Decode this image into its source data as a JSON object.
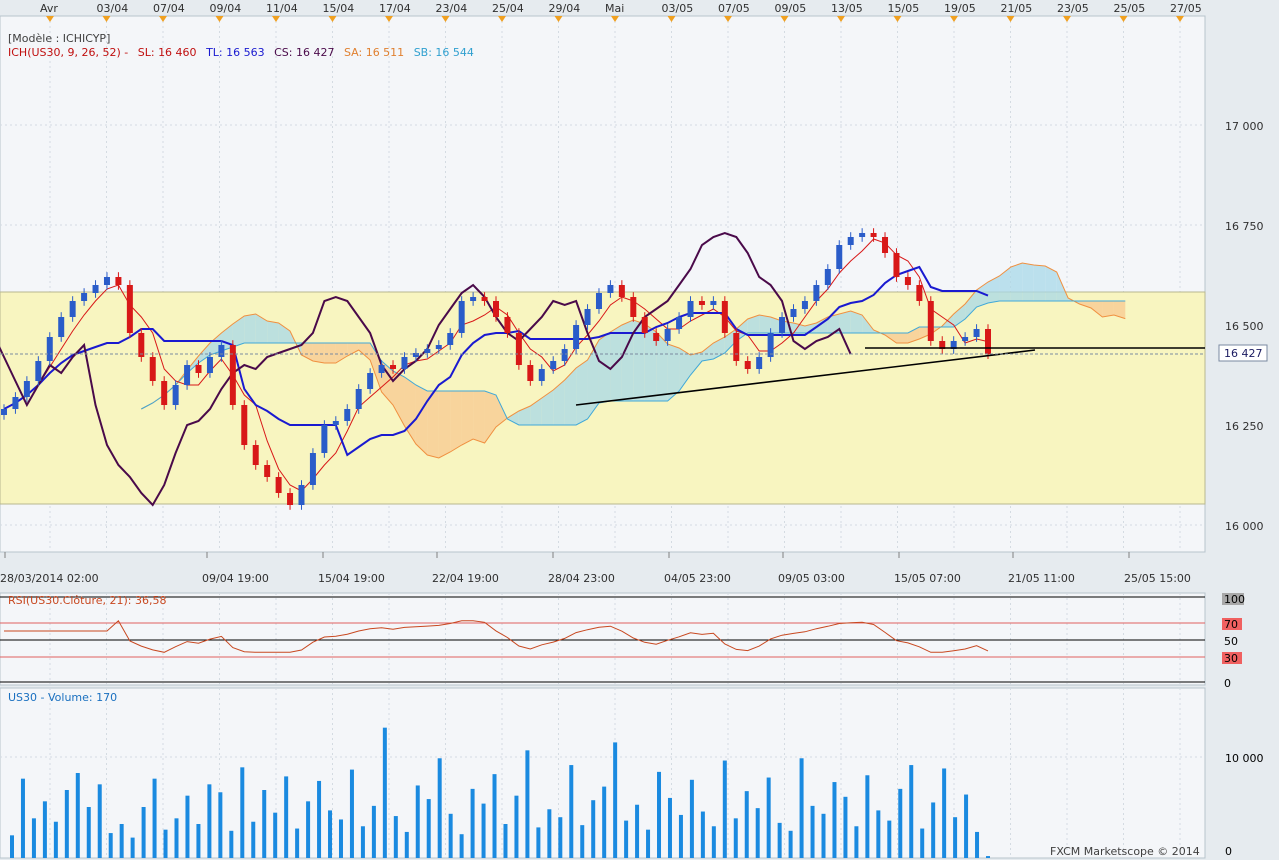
{
  "header": {
    "model_label": "[Modèle : ICHICYP]",
    "ich_prefix": "ICH(US30, 9, 26, 52) -",
    "sl": "SL: 16 460",
    "tl": "TL: 16 563",
    "cs": "CS: 16 427",
    "sa": "SA: 16 511",
    "sb": "SB: 16 544"
  },
  "top_dates": [
    "Avr",
    "03/04",
    "07/04",
    "09/04",
    "11/04",
    "15/04",
    "17/04",
    "23/04",
    "25/04",
    "29/04",
    "Mai",
    "03/05",
    "07/05",
    "09/05",
    "13/05",
    "15/05",
    "19/05",
    "21/05",
    "23/05",
    "25/05",
    "27/05"
  ],
  "time_axis": [
    "28/03/2014 02:00",
    "09/04 19:00",
    "15/04 19:00",
    "22/04 19:00",
    "28/04 23:00",
    "04/05 23:00",
    "09/05 03:00",
    "15/05 07:00",
    "21/05 11:00",
    "25/05 15:00"
  ],
  "price_axis": {
    "ticks": [
      "17 000",
      "16 750",
      "16 500",
      "16 250",
      "16 000"
    ],
    "current_label": "16 427"
  },
  "rsi": {
    "label": "RSI(US30.Clôture, 21): 36,58",
    "ticks": [
      "100",
      "70",
      "50",
      "30",
      "0"
    ]
  },
  "volume": {
    "label": "US30 - Volume: 170",
    "ticks": [
      "10 000",
      "0"
    ]
  },
  "footer": {
    "copyright": "FXCM Marketscope © 2014"
  },
  "colors": {
    "up": "#2a5cc9",
    "down": "#d81818",
    "tenkan": "#d81818",
    "kijun": "#1a1ad0",
    "chikou": "#4a0a4a",
    "senkou_a": "#f09040",
    "senkou_b": "#40a8d8",
    "cloud_bull": "#a8d8e8",
    "cloud_bear": "#f8c890",
    "range_box": "#f8f5c0",
    "volume": "#1a8ae0",
    "rsi": "#c84820"
  },
  "chart_data": [
    {
      "type": "candlestick",
      "title": "ICH(US30, 9, 26, 52)",
      "ylim": [
        15900,
        17200
      ],
      "ohlc_note": "sampled candle closes",
      "closes": [
        16290,
        16320,
        16360,
        16410,
        16470,
        16520,
        16560,
        16580,
        16600,
        16620,
        16600,
        16480,
        16420,
        16360,
        16300,
        16350,
        16400,
        16380,
        16420,
        16450,
        16300,
        16200,
        16150,
        16120,
        16080,
        16050,
        16100,
        16180,
        16250,
        16260,
        16290,
        16340,
        16380,
        16400,
        16390,
        16420,
        16430,
        16440,
        16450,
        16480,
        16560,
        16570,
        16560,
        16520,
        16480,
        16400,
        16360,
        16390,
        16410,
        16440,
        16500,
        16540,
        16580,
        16600,
        16570,
        16520,
        16480,
        16460,
        16490,
        16520,
        16560,
        16550,
        16560,
        16480,
        16410,
        16390,
        16420,
        16480,
        16520,
        16540,
        16560,
        16600,
        16640,
        16700,
        16720,
        16730,
        16720,
        16680,
        16620,
        16600,
        16560,
        16460,
        16440,
        16460,
        16470,
        16490,
        16427
      ],
      "levels": {
        "SL": 16460,
        "TL": 16563,
        "CS": 16427,
        "SA": 16511,
        "SB": 16544
      }
    },
    {
      "type": "line",
      "title": "RSI(US30.Clôture, 21)",
      "ylim": [
        0,
        100
      ],
      "levels": [
        30,
        50,
        70
      ],
      "last_value": 36.58
    },
    {
      "type": "bar",
      "title": "US30 - Volume",
      "ylim": [
        0,
        15000
      ],
      "last_value": 170,
      "values": [
        2000,
        7000,
        3500,
        5000,
        3200,
        6000,
        7500,
        4500,
        6500,
        2200,
        3000,
        1800,
        4500,
        7000,
        2500,
        3500,
        5500,
        3000,
        6500,
        5800,
        2400,
        8000,
        3200,
        6000,
        4000,
        7200,
        2600,
        5000,
        6800,
        4200,
        3400,
        7800,
        2800,
        4600,
        11500,
        3700,
        2300,
        6400,
        5200,
        8800,
        3900,
        2100,
        6100,
        4800,
        7400,
        3000,
        5500,
        9500,
        2700,
        4300,
        3600,
        8200,
        2900,
        5100,
        6300,
        10200,
        3300,
        4700,
        2500,
        7600,
        5300,
        3800,
        6900,
        4100,
        2800,
        8600,
        3500,
        5900,
        4400,
        7100,
        3100,
        2400,
        8800,
        4600,
        3900,
        6700,
        5400,
        2800,
        7300,
        4200,
        3300,
        6100,
        8200,
        2600,
        4900,
        7900,
        3600,
        5600,
        2300,
        170
      ]
    }
  ]
}
